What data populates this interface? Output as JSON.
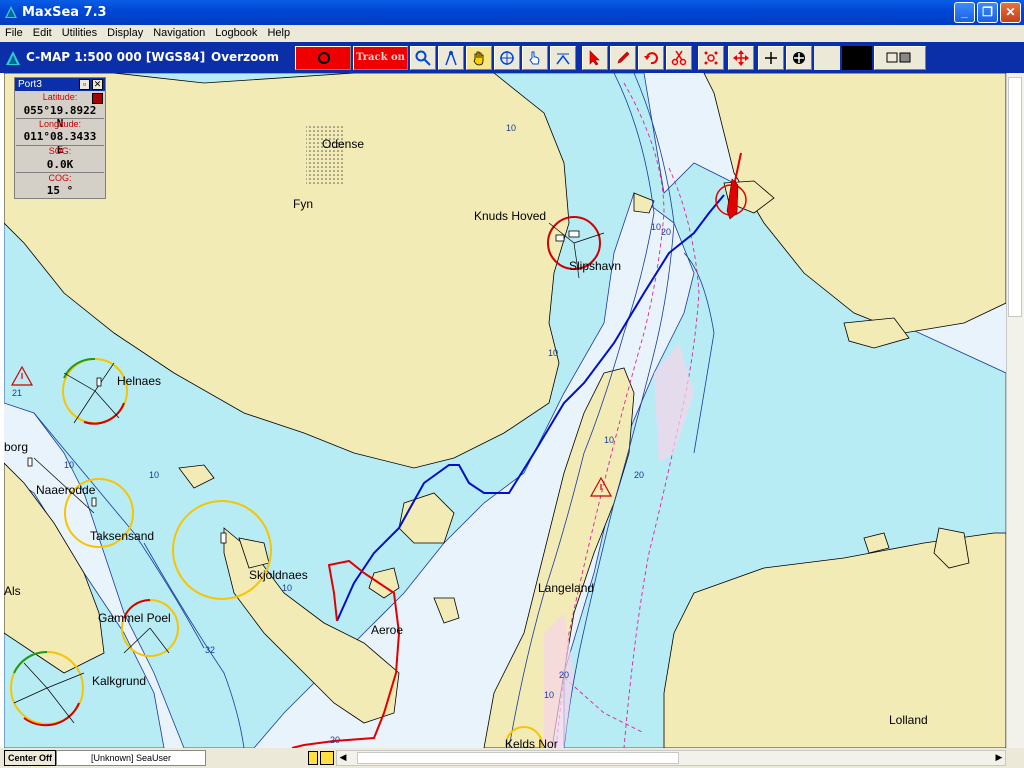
{
  "window": {
    "title": "MaxSea 7.3"
  },
  "menu": [
    "File",
    "Edit",
    "Utilities",
    "Display",
    "Navigation",
    "Logbook",
    "Help"
  ],
  "toolbar": {
    "chart_info": "C-MAP  1:500 000 [WGS84]",
    "zoom_label": "Overzoom",
    "track_label": "Track on"
  },
  "panel": {
    "title": "Port3",
    "latitude_label": "Latitude:",
    "latitude_value": "055°19.8922 N",
    "longitude_label": "Longitude:",
    "longitude_value": "011°08.3433 E",
    "sog_label": "SOG:",
    "sog_value": "0.0K",
    "cog_label": "COG:",
    "cog_value": "15 °"
  },
  "places": {
    "odense": "Odense",
    "fyn": "Fyn",
    "knuds_hoved": "Knuds Hoved",
    "slipshavn": "Slipshavn",
    "helnaes": "Helnaes",
    "borg": "borg",
    "naaerodde": "Naaerodde",
    "taksensand": "Taksensand",
    "skjoldnaes": "Skjoldnaes",
    "als": "Als",
    "gammel_poel": "Gammel Poel",
    "aeroe": "Aeroe",
    "kalkgrund": "Kalkgrund",
    "langeland": "Langeland",
    "lolland": "Lolland",
    "keldsnor": "Kelds Nor"
  },
  "depths": [
    "10",
    "20",
    "21",
    "32"
  ],
  "status": {
    "center_label": "Center Off",
    "user_label": "[Unknown] SeaUser"
  },
  "colors": {
    "land": "#f2ebb5",
    "shallow": "#b7ecf5",
    "deep": "#e8f3fb",
    "track_blue": "#0010c8",
    "route_red": "#e00000",
    "title_blue": "#0047d6",
    "toolbar_blue": "#0a2fa8"
  }
}
